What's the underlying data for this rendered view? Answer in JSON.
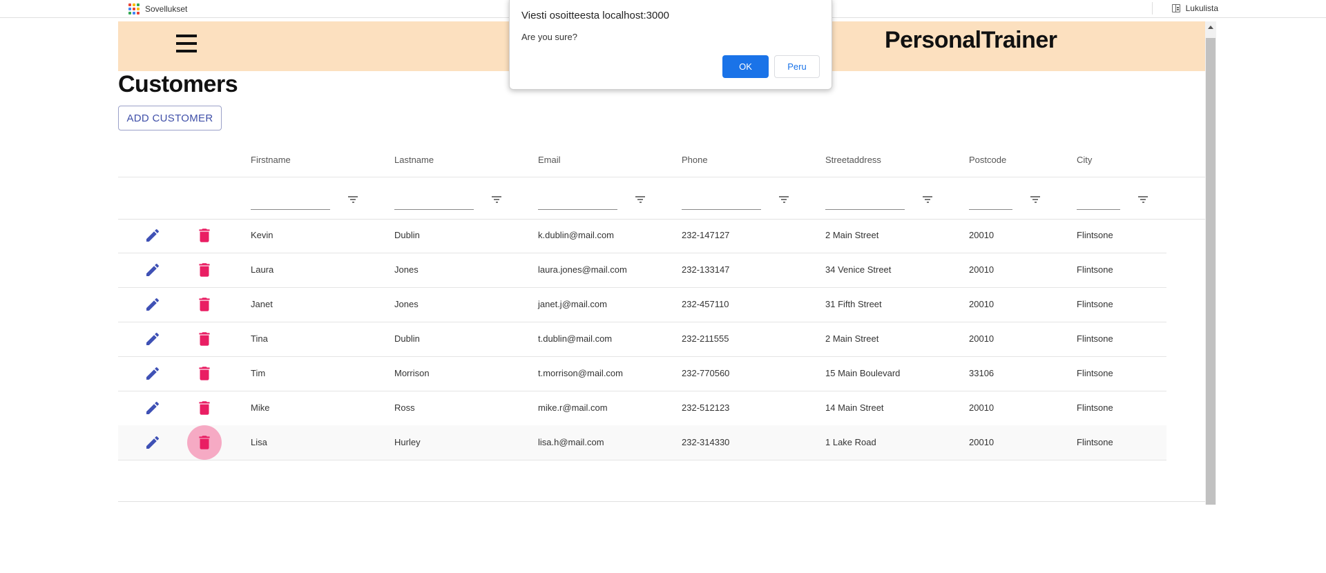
{
  "bookmarks": {
    "apps_label": "Sovellukset",
    "reading_list_label": "Lukulista"
  },
  "app": {
    "title": "PersonalTrainer"
  },
  "page": {
    "heading": "Customers",
    "add_button_label": "ADD CUSTOMER"
  },
  "table": {
    "columns": [
      "Firstname",
      "Lastname",
      "Email",
      "Phone",
      "Streetaddress",
      "Postcode",
      "City"
    ],
    "rows": [
      [
        "Kevin",
        "Dublin",
        "k.dublin@mail.com",
        "232-147127",
        "2 Main Street",
        "20010",
        "Flintsone"
      ],
      [
        "Laura",
        "Jones",
        "laura.jones@mail.com",
        "232-133147",
        "34 Venice Street",
        "20010",
        "Flintsone"
      ],
      [
        "Janet",
        "Jones",
        "janet.j@mail.com",
        "232-457110",
        "31 Fifth Street",
        "20010",
        "Flintsone"
      ],
      [
        "Tina",
        "Dublin",
        "t.dublin@mail.com",
        "232-211555",
        "2 Main Street",
        "20010",
        "Flintsone"
      ],
      [
        "Tim",
        "Morrison",
        "t.morrison@mail.com",
        "232-770560",
        "15 Main Boulevard",
        "33106",
        "Flintsone"
      ],
      [
        "Mike",
        "Ross",
        "mike.r@mail.com",
        "232-512123",
        "14 Main Street",
        "20010",
        "Flintsone"
      ],
      [
        "Lisa",
        "Hurley",
        "lisa.h@mail.com",
        "232-314330",
        "1 Lake Road",
        "20010",
        "Flintsone"
      ]
    ],
    "active_delete_row": 6
  },
  "dialog": {
    "title": "Viesti osoitteesta localhost:3000",
    "message": "Are you sure?",
    "ok_label": "OK",
    "cancel_label": "Peru"
  },
  "colors": {
    "header_bg": "#fce0bf",
    "edit_icon": "#3f51b5",
    "delete_icon": "#e91e63",
    "dialog_primary": "#1a73e8"
  },
  "icons": {
    "menu": "hamburger-menu-icon",
    "edit": "pencil-icon",
    "delete": "trash-icon",
    "filter": "filter-icon",
    "apps": "apps-grid-icon",
    "reading_list": "reading-list-icon"
  }
}
